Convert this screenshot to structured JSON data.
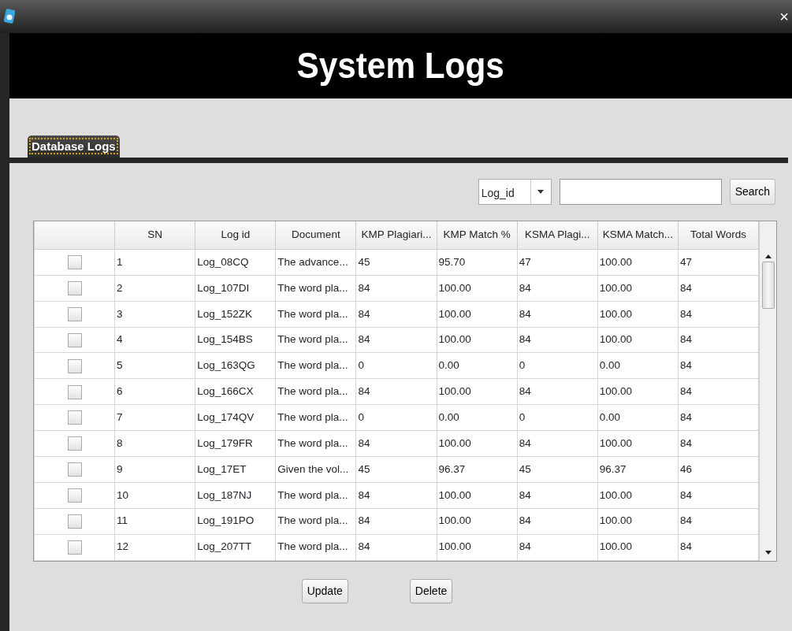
{
  "window": {
    "close": "×"
  },
  "banner": {
    "title": "System Logs"
  },
  "tabs": [
    {
      "label": "Database Logs",
      "selected": true
    }
  ],
  "search": {
    "field_select": "Log_id",
    "button": "Search"
  },
  "table": {
    "columns": [
      "SN",
      "Log id",
      "Document",
      "KMP Plagiari...",
      "KMP Match %",
      "KSMA Plagi...",
      "KSMA Match...",
      "Total Words"
    ],
    "rows": [
      {
        "checked": false,
        "cells": [
          "1",
          "Log_08CQ",
          "The advance...",
          "45",
          "95.70",
          "47",
          "100.00",
          "47"
        ]
      },
      {
        "checked": false,
        "cells": [
          "2",
          "Log_107DI",
          "The word pla...",
          "84",
          "100.00",
          "84",
          "100.00",
          "84"
        ]
      },
      {
        "checked": false,
        "cells": [
          "3",
          "Log_152ZK",
          "The word pla...",
          "84",
          "100.00",
          "84",
          "100.00",
          "84"
        ]
      },
      {
        "checked": false,
        "cells": [
          "4",
          "Log_154BS",
          "The word pla...",
          "84",
          "100.00",
          "84",
          "100.00",
          "84"
        ]
      },
      {
        "checked": false,
        "cells": [
          "5",
          "Log_163QG",
          "The word pla...",
          "0",
          "0.00",
          "0",
          "0.00",
          "84"
        ]
      },
      {
        "checked": false,
        "cells": [
          "6",
          "Log_166CX",
          "The word pla...",
          "84",
          "100.00",
          "84",
          "100.00",
          "84"
        ]
      },
      {
        "checked": false,
        "cells": [
          "7",
          "Log_174QV",
          "The word pla...",
          "0",
          "0.00",
          "0",
          "0.00",
          "84"
        ]
      },
      {
        "checked": false,
        "cells": [
          "8",
          "Log_179FR",
          "The word pla...",
          "84",
          "100.00",
          "84",
          "100.00",
          "84"
        ]
      },
      {
        "checked": false,
        "cells": [
          "9",
          "Log_17ET",
          "Given the vol...",
          "45",
          "96.37",
          "45",
          "96.37",
          "46"
        ]
      },
      {
        "checked": false,
        "cells": [
          "10",
          "Log_187NJ",
          "The word pla...",
          "84",
          "100.00",
          "84",
          "100.00",
          "84"
        ]
      },
      {
        "checked": false,
        "cells": [
          "11",
          "Log_191PO",
          "The word pla...",
          "84",
          "100.00",
          "84",
          "100.00",
          "84"
        ]
      },
      {
        "checked": false,
        "cells": [
          "12",
          "Log_207TT",
          "The word pla...",
          "84",
          "100.00",
          "84",
          "100.00",
          "84"
        ]
      }
    ]
  },
  "buttons": [
    "Update",
    "Delete"
  ]
}
